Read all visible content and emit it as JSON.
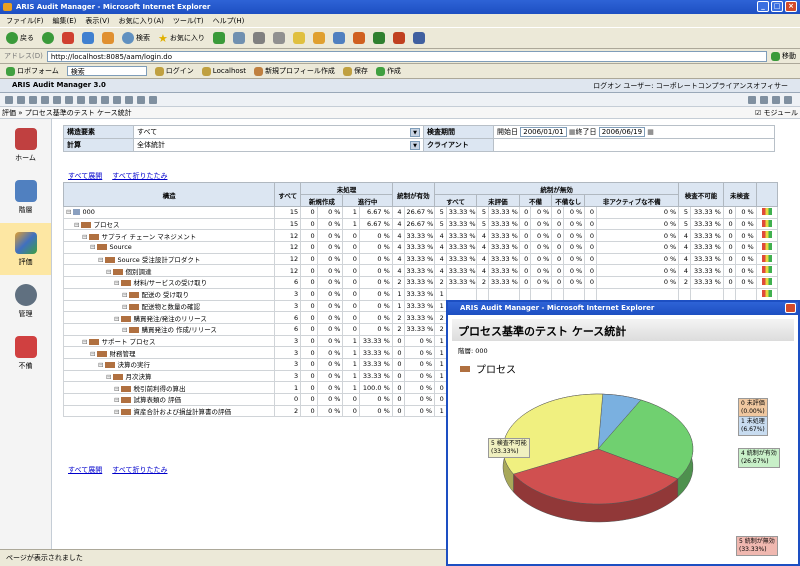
{
  "window": {
    "title": "ARIS Audit Manager - Microsoft Internet Explorer"
  },
  "menu": [
    "ファイル(F)",
    "編集(E)",
    "表示(V)",
    "お気に入り(A)",
    "ツール(T)",
    "ヘルプ(H)"
  ],
  "toolbar": {
    "back": "戻る",
    "search": "検索",
    "favorites": "お気に入り"
  },
  "address": {
    "label": "アドレス(D)",
    "url": "http://localhost:8085/aam/login.do",
    "go": "移動"
  },
  "links": {
    "roboform": "ロボフォーム",
    "search_select": "検索",
    "login": "ログイン",
    "localhost": "Localhost",
    "new_profile": "新規プロフィール作成",
    "save": "保存",
    "create": "作成"
  },
  "app": {
    "name": "ARIS Audit Manager 3.0",
    "login_user": "ログオン ユーザー: コーポレートコンプライアンスオフィサー"
  },
  "breadcrumb": {
    "path": "評価 » プロセス基準のテスト ケース統計",
    "module": "モジュール"
  },
  "nav": [
    {
      "label": "ホーム"
    },
    {
      "label": "階層"
    },
    {
      "label": "評価"
    },
    {
      "label": "管理"
    },
    {
      "label": "不備"
    }
  ],
  "form": {
    "structure_label": "構造要素",
    "structure_value": "すべて",
    "period_label": "検査期間",
    "start_label": "開始日",
    "start_date": "2006/01/01",
    "end_label": "終了日",
    "end_date": "2006/06/19",
    "calc_label": "計算",
    "calc_value": "全体統計",
    "client_label": "クライアント",
    "client_value": ""
  },
  "expand": {
    "expand_all": "すべて展開",
    "collapse_all": "すべて折りたたみ"
  },
  "table": {
    "h_structure": "構造",
    "h_all": "すべて",
    "h_unprocessed": "未処理",
    "h_new": "新規作成",
    "h_inprogress": "進行中",
    "h_effective": "統制が有効",
    "h_ineffective": "統制が無効",
    "h_all2": "すべて",
    "h_unevaluated": "未評価",
    "h_deficient": "不備",
    "h_nodeficiency": "不備なし",
    "h_inactive": "非アクティブな不備",
    "h_notcheckable": "検査不可能",
    "h_unchecked": "未検査",
    "rows": [
      {
        "name": "000",
        "c": [
          "15",
          "0",
          "0 %",
          "1",
          "6.67 %",
          "4",
          "26.67 %",
          "5",
          "33.33 %",
          "5",
          "33.33 %",
          "0",
          "0 %",
          "0",
          "0 %",
          "0",
          "0 %",
          "5",
          "33.33 %",
          "0",
          "0 %"
        ]
      },
      {
        "name": "プロセス",
        "c": [
          "15",
          "0",
          "0 %",
          "1",
          "6.67 %",
          "4",
          "26.67 %",
          "5",
          "33.33 %",
          "5",
          "33.33 %",
          "0",
          "0 %",
          "0",
          "0 %",
          "0",
          "0 %",
          "5",
          "33.33 %",
          "0",
          "0 %"
        ]
      },
      {
        "name": "サプライ チェーン マネジメント",
        "c": [
          "12",
          "0",
          "0 %",
          "0",
          "0 %",
          "4",
          "33.33 %",
          "4",
          "33.33 %",
          "4",
          "33.33 %",
          "0",
          "0 %",
          "0",
          "0 %",
          "0",
          "0 %",
          "4",
          "33.33 %",
          "0",
          "0 %"
        ]
      },
      {
        "name": "Source",
        "c": [
          "12",
          "0",
          "0 %",
          "0",
          "0 %",
          "4",
          "33.33 %",
          "4",
          "33.33 %",
          "4",
          "33.33 %",
          "0",
          "0 %",
          "0",
          "0 %",
          "0",
          "0 %",
          "4",
          "33.33 %",
          "0",
          "0 %"
        ]
      },
      {
        "name": "Source 受注設計プロダクト",
        "c": [
          "12",
          "0",
          "0 %",
          "0",
          "0 %",
          "4",
          "33.33 %",
          "4",
          "33.33 %",
          "4",
          "33.33 %",
          "0",
          "0 %",
          "0",
          "0 %",
          "0",
          "0 %",
          "4",
          "33.33 %",
          "0",
          "0 %"
        ]
      },
      {
        "name": "個別調達",
        "c": [
          "12",
          "0",
          "0 %",
          "0",
          "0 %",
          "4",
          "33.33 %",
          "4",
          "33.33 %",
          "4",
          "33.33 %",
          "0",
          "0 %",
          "0",
          "0 %",
          "0",
          "0 %",
          "4",
          "33.33 %",
          "0",
          "0 %"
        ]
      },
      {
        "name": "材料/サービスの受け取り",
        "c": [
          "6",
          "0",
          "0 %",
          "0",
          "0 %",
          "2",
          "33.33 %",
          "2",
          "33.33 %",
          "2",
          "33.33 %",
          "0",
          "0 %",
          "0",
          "0 %",
          "0",
          "0 %",
          "2",
          "33.33 %",
          "0",
          "0 %"
        ]
      },
      {
        "name": "配送の 受け取り",
        "c": [
          "3",
          "0",
          "0 %",
          "0",
          "0 %",
          "1",
          "33.33 %",
          "1",
          "",
          "",
          "",
          "",
          "",
          "",
          "",
          "",
          "",
          "",
          "",
          "",
          ""
        ]
      },
      {
        "name": "配送物と数量の確認",
        "c": [
          "3",
          "0",
          "0 %",
          "0",
          "0 %",
          "1",
          "33.33 %",
          "1",
          "",
          "",
          "",
          "",
          "",
          "",
          "",
          "",
          "",
          "",
          "",
          "",
          ""
        ]
      },
      {
        "name": "購買発注/発注のリリース",
        "c": [
          "6",
          "0",
          "0 %",
          "0",
          "0 %",
          "2",
          "33.33 %",
          "2",
          "",
          "",
          "",
          "",
          "",
          "",
          "",
          "",
          "",
          "",
          "",
          "",
          ""
        ]
      },
      {
        "name": "購買発注の 作成/リリース",
        "c": [
          "6",
          "0",
          "0 %",
          "0",
          "0 %",
          "2",
          "33.33 %",
          "2",
          "",
          "",
          "",
          "",
          "",
          "",
          "",
          "",
          "",
          "",
          "",
          "",
          ""
        ]
      },
      {
        "name": "サポート プロセス",
        "c": [
          "3",
          "0",
          "0 %",
          "1",
          "33.33 %",
          "0",
          "0 %",
          "1",
          "",
          "",
          "",
          "",
          "",
          "",
          "",
          "",
          "",
          "",
          "",
          "",
          ""
        ]
      },
      {
        "name": "財務管理",
        "c": [
          "3",
          "0",
          "0 %",
          "1",
          "33.33 %",
          "0",
          "0 %",
          "1",
          "",
          "",
          "",
          "",
          "",
          "",
          "",
          "",
          "",
          "",
          "",
          "",
          ""
        ]
      },
      {
        "name": "決算の実行",
        "c": [
          "3",
          "0",
          "0 %",
          "1",
          "33.33 %",
          "0",
          "0 %",
          "1",
          "",
          "",
          "",
          "",
          "",
          "",
          "",
          "",
          "",
          "",
          "",
          "",
          ""
        ]
      },
      {
        "name": "月次決算",
        "c": [
          "3",
          "0",
          "0 %",
          "1",
          "33.33 %",
          "0",
          "0 %",
          "1",
          "",
          "",
          "",
          "",
          "",
          "",
          "",
          "",
          "",
          "",
          "",
          "",
          ""
        ]
      },
      {
        "name": "税引前利得の算出",
        "c": [
          "1",
          "0",
          "0 %",
          "1",
          "100.0 %",
          "0",
          "0 %",
          "0",
          "",
          "",
          "",
          "",
          "",
          "",
          "",
          "",
          "",
          "",
          "",
          "",
          ""
        ]
      },
      {
        "name": "試算表類の 評価",
        "c": [
          "0",
          "0",
          "0 %",
          "0",
          "0 %",
          "0",
          "0 %",
          "0",
          "",
          "",
          "",
          "",
          "",
          "",
          "",
          "",
          "",
          "",
          "",
          "",
          ""
        ]
      },
      {
        "name": "資産合計および損益計算書の評価",
        "c": [
          "2",
          "0",
          "0 %",
          "0",
          "0 %",
          "0",
          "0 %",
          "1",
          "",
          "",
          "",
          "",
          "",
          "",
          "",
          "",
          "",
          "",
          "",
          "",
          ""
        ]
      }
    ]
  },
  "status": "ページが表示されました",
  "popup": {
    "title": "ARIS Audit Manager - Microsoft Internet Explorer",
    "heading": "プロセス基準のテスト ケース統計",
    "sub": "階層: 000",
    "process": "プロセス",
    "legend": [
      {
        "label": "0 未評価",
        "pct": "(0.00%)",
        "color": "#f0c8a0"
      },
      {
        "label": "1 未処理",
        "pct": "(6.67%)",
        "color": "#c8dcf0"
      },
      {
        "label": "4 統制が有効",
        "pct": "(26.67%)",
        "color": "#c8f0c8"
      },
      {
        "label": "5 統制が無効",
        "pct": "(33.33%)",
        "color": "#f0b8b0"
      },
      {
        "label": "5 検査不可能",
        "pct": "(33.33%)",
        "color": "#f0f0c0"
      }
    ]
  },
  "chart_data": {
    "type": "pie",
    "title": "プロセス基準のテスト ケース統計",
    "labels": [
      "未評価",
      "未処理",
      "統制が有効",
      "統制が無効",
      "検査不可能"
    ],
    "values": [
      0,
      1,
      4,
      5,
      5
    ],
    "percents": [
      0,
      6.67,
      26.67,
      33.33,
      33.33
    ],
    "colors": [
      "#e8a060",
      "#7ab0e0",
      "#70d070",
      "#d05050",
      "#f0f080"
    ]
  }
}
